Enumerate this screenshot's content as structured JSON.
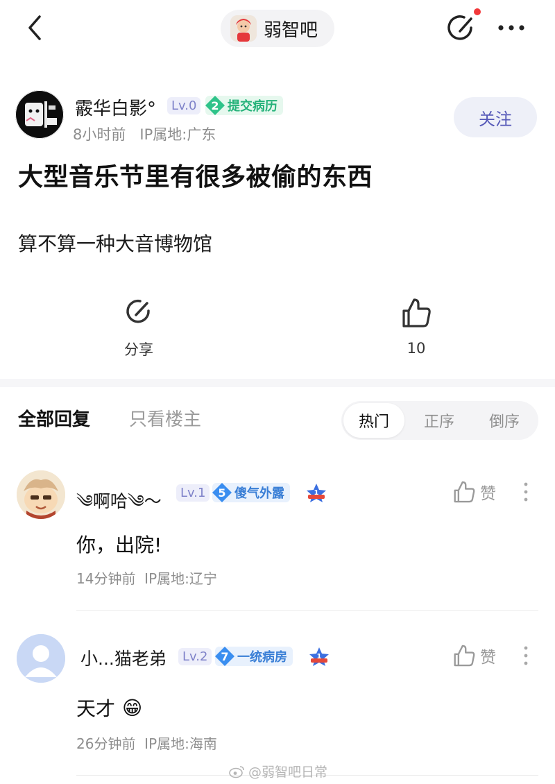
{
  "header": {
    "forum_name": "弱智吧"
  },
  "post": {
    "author": {
      "name": "霰华白影°",
      "level": "Lv.0",
      "badge_num": "2",
      "badge_title": "提交病历",
      "time": "8小时前",
      "ip": "IP属地:广东",
      "follow_label": "关注"
    },
    "title": "大型音乐节里有很多被偷的东西",
    "body": "算不算一种大音博物馆",
    "share_label": "分享",
    "like_count": "10"
  },
  "replies_section": {
    "tab_all": "全部回复",
    "tab_owner": "只看楼主",
    "sort_options": [
      "热门",
      "正序",
      "倒序"
    ],
    "active_sort": "热门"
  },
  "replies": [
    {
      "name": "༄啊哈༄〜",
      "level": "Lv.1",
      "badge_num": "5",
      "badge_title": "傻气外露",
      "star_num": "1",
      "text": "你，出院!",
      "time": "14分钟前",
      "ip": "IP属地:辽宁",
      "like_label": "赞"
    },
    {
      "name": "小...猫老弟",
      "level": "Lv.2",
      "badge_num": "7",
      "badge_title": "一统病房",
      "star_num": "1",
      "text": "天才",
      "emoji": "😁",
      "time": "26分钟前",
      "ip": "IP属地:海南",
      "like_label": "赞"
    }
  ],
  "watermark": "@弱智吧日常",
  "colors": {
    "accent": "#5659b8",
    "level_badge_bg": "#edeefa",
    "green_badge": "#2fc38a",
    "blue_badge": "#3a8ef0",
    "red_dot": "#f2383a"
  }
}
